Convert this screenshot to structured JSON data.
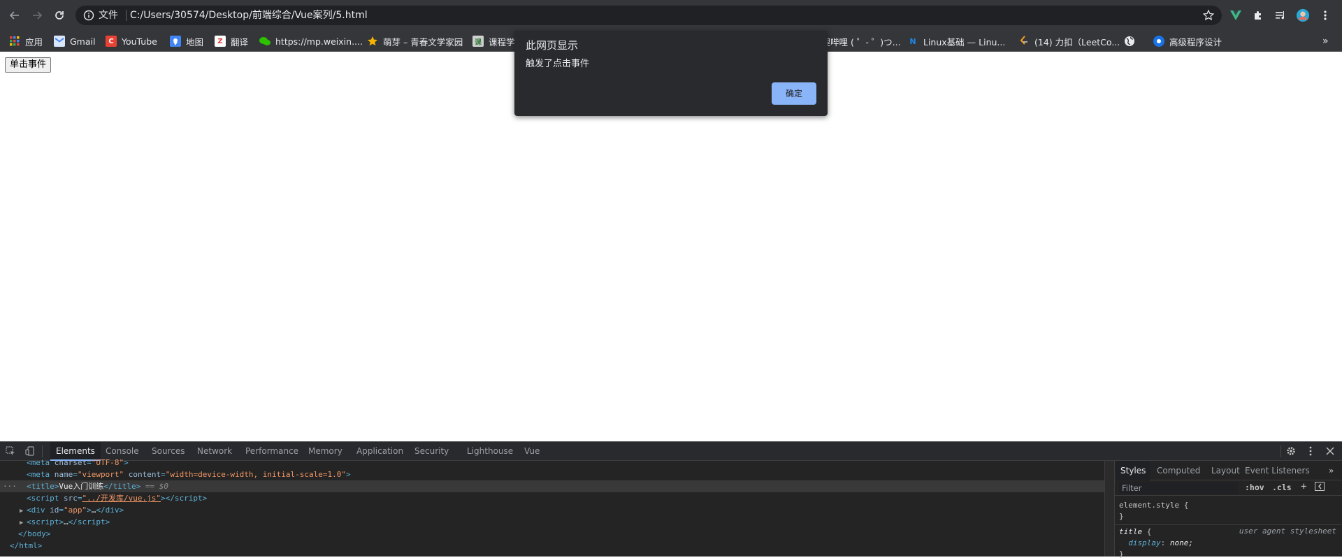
{
  "browser": {
    "omnibox": {
      "security_label": "文件",
      "url": "C:/Users/30574/Desktop/前端综合/Vue案列/5.html"
    },
    "bookmarks": [
      {
        "label": "应用",
        "icon": "apps-grid-icon",
        "color": "#ea4335"
      },
      {
        "label": "Gmail",
        "icon": "gmail-icon",
        "color": "#4285f4"
      },
      {
        "label": "YouTube",
        "icon": "youtube-icon",
        "color": "#e94235"
      },
      {
        "label": "地图",
        "icon": "maps-icon",
        "color": "#4285f4"
      },
      {
        "label": "翻译",
        "icon": "translate-icon",
        "color": "#e53935"
      },
      {
        "label": "https://mp.weixin....",
        "icon": "wechat-icon",
        "color": "#2dc100"
      },
      {
        "label": "萌芽 – 青春文学家园",
        "icon": "star-bookmark-icon",
        "color": "#f4b400"
      },
      {
        "label": "课程学",
        "icon": "course-icon",
        "color": "#cfcfcf"
      },
      {
        "label": "哔哩哔哩 ( ゜- ゜)つ...",
        "icon": "bilibili-icon",
        "color": "#00a1d6"
      },
      {
        "label": "Linux基础 — Linu...",
        "icon": "linux-icon",
        "color": "#1e88e5"
      },
      {
        "label": "(14) 力扣（LeetCo...",
        "icon": "leetcode-icon",
        "color": "#f89f1b"
      },
      {
        "label": "",
        "icon": "globe-icon",
        "color": "#e8eaed"
      },
      {
        "label": "高级程序设计",
        "icon": "advanced-programming-icon",
        "color": "#1a73e8"
      }
    ]
  },
  "page": {
    "button_label": "单击事件"
  },
  "alert": {
    "title": "此网页显示",
    "message": "触发了点击事件",
    "ok_label": "确定",
    "ok_color": "#8ab4f8"
  },
  "devtools": {
    "tabs": [
      "Elements",
      "Console",
      "Sources",
      "Network",
      "Performance",
      "Memory",
      "Application",
      "Security",
      "Lighthouse",
      "Vue"
    ],
    "active_tab": "Elements",
    "dom": {
      "line1_attr": "charset",
      "line1_val": "\"UTF-8\"",
      "line2_attr1": "name",
      "line2_val1": "\"viewport\"",
      "line2_attr2": "content",
      "line2_val2": "\"width=device-width, initial-scale=1.0\"",
      "title_text": "Vue入门训练",
      "selected_marker": "== $0",
      "script_src": "\"../开发库/vue.js\"",
      "div_id": "\"app\""
    },
    "styles": {
      "tabs": [
        "Styles",
        "Computed",
        "Layout",
        "Event Listeners"
      ],
      "filter_placeholder": "Filter",
      "hov": ":hov",
      "cls": ".cls",
      "element_style": "element.style {",
      "close_brace": "}",
      "rule_selector": "title",
      "rule_origin": "user agent stylesheet",
      "rule_prop": "display",
      "rule_value": "none;"
    }
  }
}
